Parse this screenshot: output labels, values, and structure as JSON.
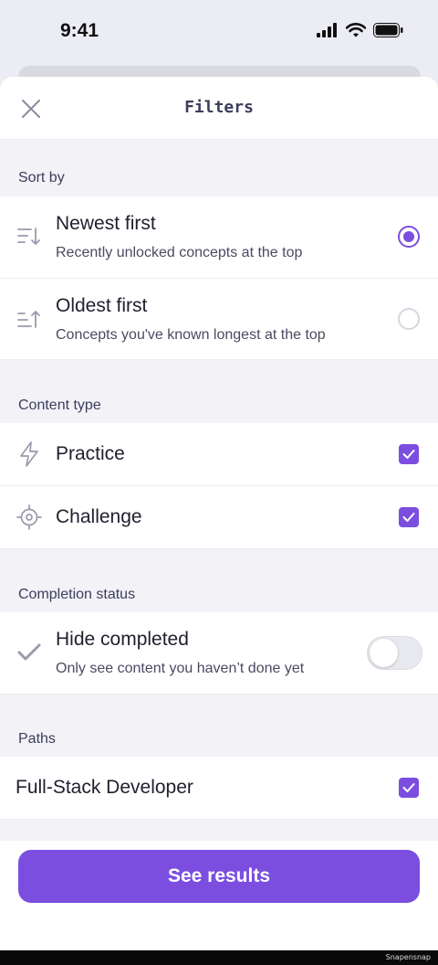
{
  "status_bar": {
    "time": "9:41"
  },
  "header": {
    "title": "Filters"
  },
  "sort": {
    "label": "Sort by",
    "options": [
      {
        "title": "Newest first",
        "subtitle": "Recently unlocked concepts at the top",
        "selected": true
      },
      {
        "title": "Oldest first",
        "subtitle": "Concepts you've known longest at the top",
        "selected": false
      }
    ]
  },
  "content_type": {
    "label": "Content type",
    "items": [
      {
        "title": "Practice",
        "checked": true
      },
      {
        "title": "Challenge",
        "checked": true
      }
    ]
  },
  "completion": {
    "label": "Completion status",
    "title": "Hide completed",
    "subtitle": "Only see content you haven’t done yet",
    "on": false
  },
  "paths": {
    "label": "Paths",
    "items": [
      {
        "title": "Full-Stack Developer",
        "checked": true
      }
    ]
  },
  "footer": {
    "cta_label": "See results"
  },
  "watermark": "Snapensnap",
  "colors": {
    "accent": "#7b4ee0",
    "background": "#f2f2f7",
    "text": "#1f1f2e"
  },
  "icons": {
    "close": "close-icon",
    "newest": "sort-descending-icon",
    "oldest": "sort-ascending-icon",
    "practice": "lightning-icon",
    "challenge": "target-icon",
    "completed": "checkmark-icon"
  }
}
